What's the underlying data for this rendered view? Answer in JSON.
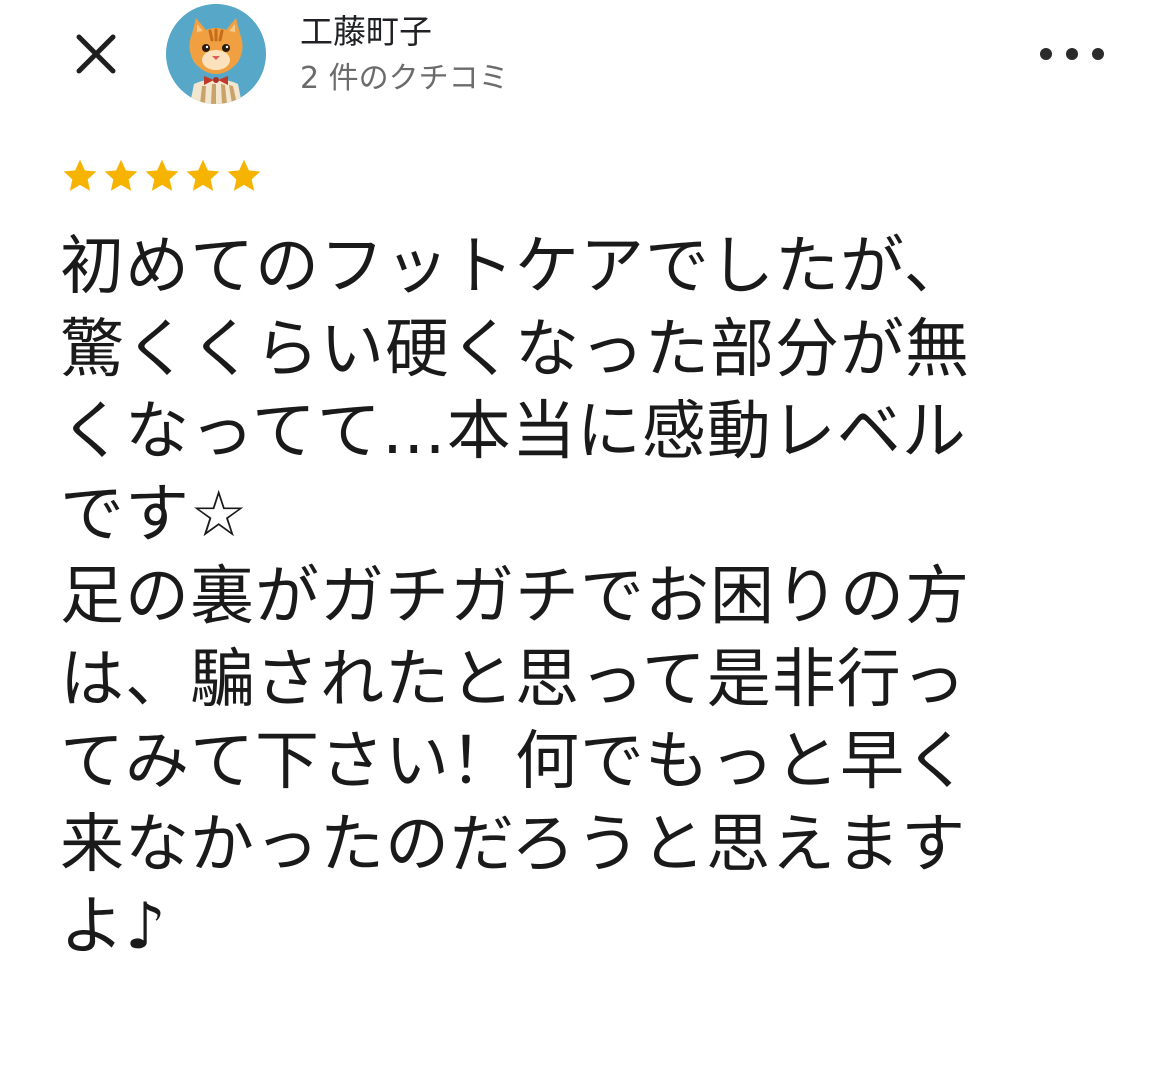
{
  "header": {
    "close_icon": "close-icon",
    "more_icon": "more-horizontal-icon",
    "avatar_icon": "cat-avatar-icon"
  },
  "reviewer": {
    "name": "工藤町子",
    "review_count": "2 件のクチコミ"
  },
  "rating": {
    "stars": 5,
    "max_stars": 5,
    "star_color": "#F6B400"
  },
  "review": {
    "text": "初めてのフットケアでしたが、\n驚くくらい硬くなった部分が無\nくなってて…本当に感動レベル\nです☆\n足の裏がガチガチでお困りの方\nは、騙されたと思って是非行っ\nてみて下さい！何でもっと早く\n来なかったのだろうと思えます\nよ♪"
  }
}
